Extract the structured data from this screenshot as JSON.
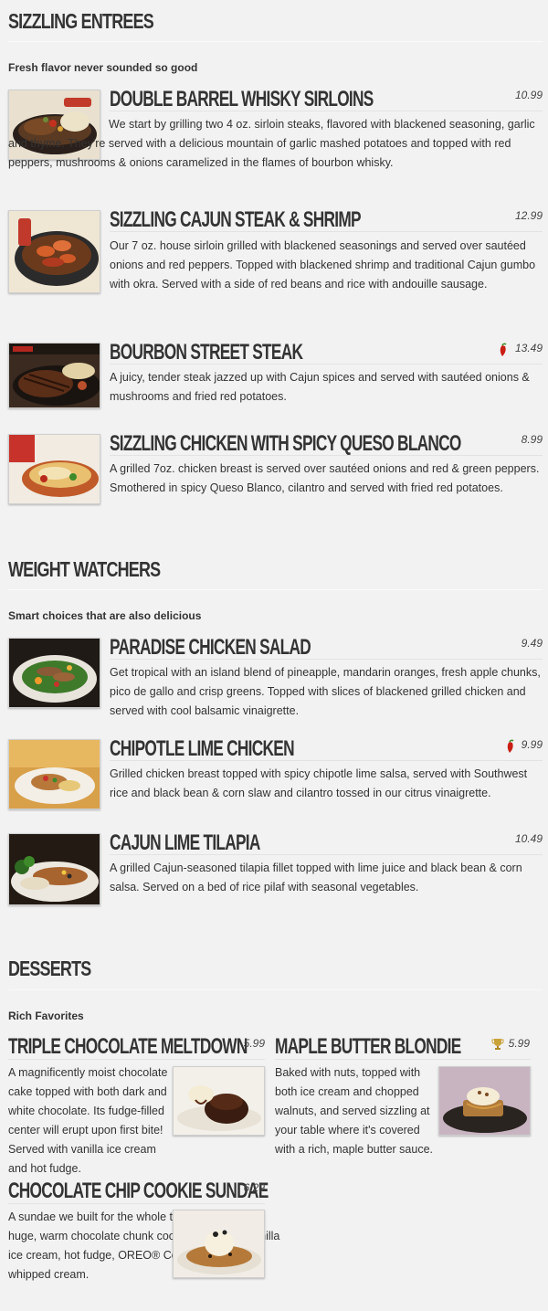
{
  "sections": [
    {
      "title": "SIZZLING ENTREES",
      "subtitle": "Fresh flavor never sounded so good",
      "items": [
        {
          "name": "DOUBLE BARREL WHISKY SIRLOINS",
          "price": "10.99",
          "icon": "",
          "description": "We start by grilling two 4 oz. sirloin steaks, flavored with blackened seasoning, garlic and thyme. They're served with a delicious mountain of garlic mashed potatoes and topped with red peppers, mushrooms & onions caramelized in the flames of bourbon whisky."
        },
        {
          "name": "SIZZLING CAJUN STEAK & SHRIMP",
          "price": "12.99",
          "icon": "",
          "description": "Our 7 oz. house sirloin grilled with blackened seasonings and served over sautéed onions and red peppers. Topped with blackened shrimp and traditional Cajun gumbo with okra. Served with a side of red beans and rice with andouille sausage."
        },
        {
          "name": "BOURBON STREET STEAK",
          "price": "13.49",
          "icon": "chili-pepper-icon",
          "description": "A juicy, tender steak jazzed up with Cajun spices and served with sautéed onions & mushrooms and fried red potatoes."
        },
        {
          "name": "SIZZLING CHICKEN WITH SPICY QUESO BLANCO",
          "price": "8.99",
          "icon": "",
          "description": "A grilled 7oz. chicken breast is served over sautéed onions and red & green peppers. Smothered in spicy Queso Blanco, cilantro and served with fried red potatoes."
        }
      ]
    },
    {
      "title": "WEIGHT WATCHERS",
      "subtitle": "Smart choices that are also delicious",
      "items": [
        {
          "name": "PARADISE CHICKEN SALAD",
          "price": "9.49",
          "icon": "",
          "description": "Get tropical with an island blend of pineapple, mandarin oranges, fresh apple chunks, pico de gallo and crisp greens. Topped with slices of blackened grilled chicken and served with cool balsamic vinaigrette."
        },
        {
          "name": "CHIPOTLE LIME CHICKEN",
          "price": "9.99",
          "icon": "chili-pepper-icon",
          "description": "Grilled chicken breast topped with spicy chipotle lime salsa, served with Southwest rice and black bean & corn slaw and cilantro tossed in our citrus vinaigrette."
        },
        {
          "name": "CAJUN LIME TILAPIA",
          "price": "10.49",
          "icon": "",
          "description": "A grilled Cajun-seasoned tilapia fillet topped with lime juice and black bean & corn salsa. Served on a bed of rice pilaf with seasonal vegetables."
        }
      ]
    },
    {
      "title": "DESSERTS",
      "subtitle": "Rich Favorites",
      "items": [
        {
          "name": "TRIPLE CHOCOLATE MELTDOWN",
          "price": "5.99",
          "icon": "",
          "description": "A magnificently moist chocolate cake topped with both dark and white chocolate. Its fudge-filled center will erupt upon first bite! Served with vanilla ice cream and hot fudge."
        },
        {
          "name": "MAPLE BUTTER BLONDIE",
          "price": "5.99",
          "icon": "trophy-icon",
          "description": "Baked with nuts, topped with both ice cream and chopped walnuts, and served sizzling at your table where it's covered with a rich, maple butter sauce."
        },
        {
          "name": "CHOCOLATE CHIP COOKIE SUNDAE",
          "price": "6.29",
          "icon": "",
          "description": "A sundae we built for the whole table! We take a huge, warm chocolate chunk cookie, top it with vanilla ice cream, hot fudge, OREO® Cookie Pieces, and whipped cream."
        }
      ]
    }
  ]
}
